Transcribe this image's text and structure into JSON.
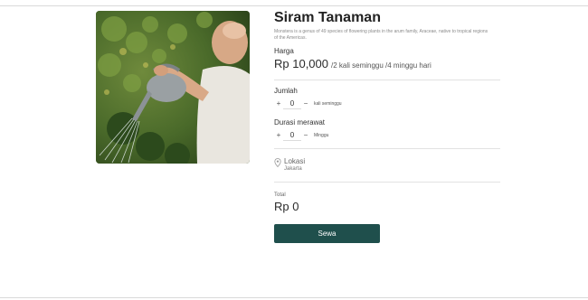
{
  "product": {
    "title": "Siram Tanaman",
    "description": "Monstera is a genus of 49 species of flowering plants in the arum family, Araceae, native to tropical regions of the Americas."
  },
  "price": {
    "label": "Harga",
    "amount": "Rp 10,000",
    "unit": "/2 kali seminggu /4 minggu hari"
  },
  "quantity": {
    "label": "Jumlah",
    "plus": "+",
    "value": "0",
    "minus": "−",
    "unit": "kali seminggu"
  },
  "duration": {
    "label": "Durasi merawat",
    "plus": "+",
    "value": "0",
    "minus": "−",
    "unit": "Minggu"
  },
  "location": {
    "label": "Lokasi",
    "value": "Jakarta",
    "icon": "location-pin-icon"
  },
  "total": {
    "label": "Total",
    "value": "Rp 0"
  },
  "action": {
    "rent_label": "Sewa"
  },
  "colors": {
    "button": "#1f4f4c"
  }
}
